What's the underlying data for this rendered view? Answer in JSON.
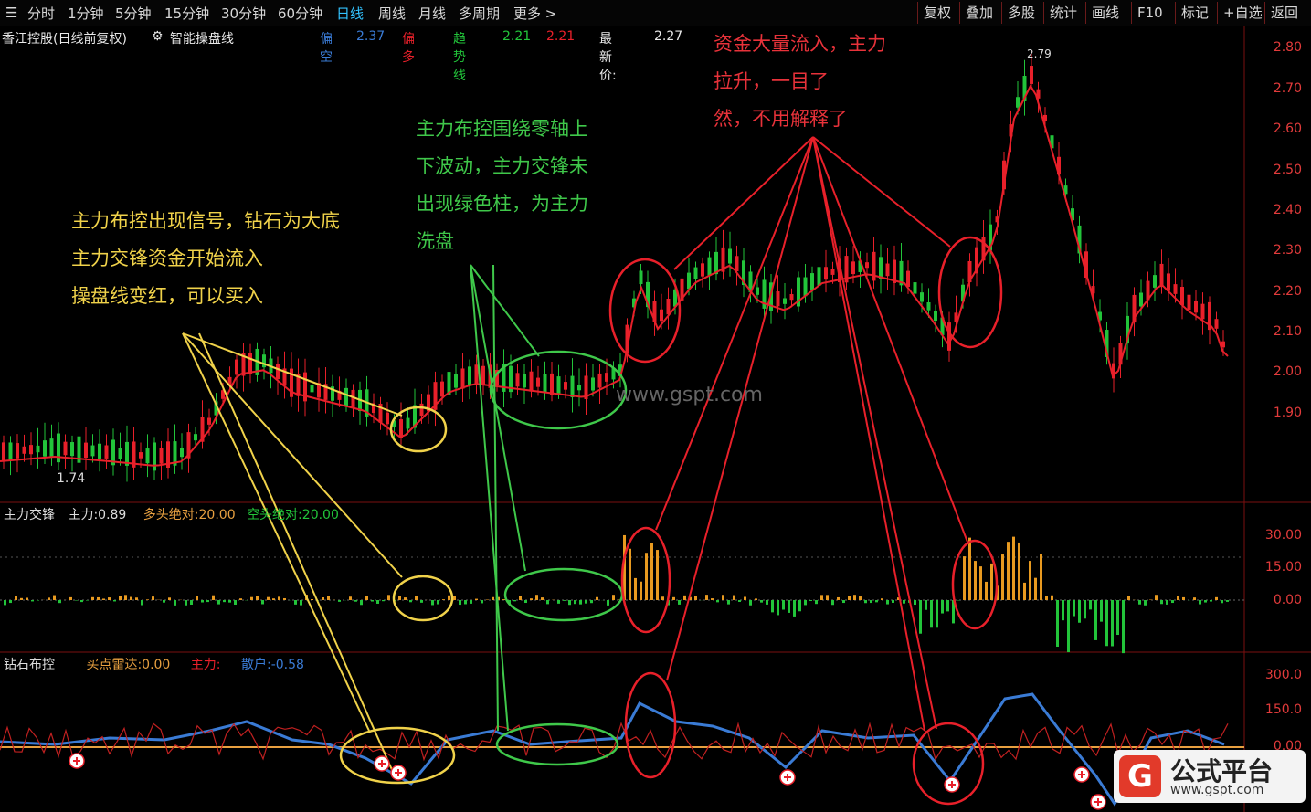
{
  "toolbar": {
    "periods": [
      "分时",
      "1分钟",
      "5分钟",
      "15分钟",
      "30分钟",
      "60分钟",
      "日线",
      "周线",
      "月线",
      "多周期",
      "更多 >"
    ],
    "active_period": "日线",
    "buttons": [
      "复权",
      "叠加",
      "多股",
      "统计",
      "画线",
      "F10",
      "标记",
      "+自选",
      "返回"
    ]
  },
  "info": {
    "stock": "香江控股(日线前复权)",
    "indicator": "智能操盘线",
    "empty_label": "偏空",
    "empty_value": "2.37",
    "multi_label": "偏多",
    "trend_label": "趋势线",
    "trend_value": "2.21",
    "trend_value2": "2.21",
    "latest_label": "最新价:",
    "latest_value": "2.27"
  },
  "price_axis": [
    "2.80",
    "2.70",
    "2.60",
    "2.50",
    "2.40",
    "2.30",
    "2.20",
    "2.10",
    "2.00",
    "1.90"
  ],
  "low_marker": "1.74",
  "high_marker": "2.79",
  "panel2": {
    "name": "主力交锋",
    "main_label": "主力:",
    "main_value": "0.89",
    "long_label": "多头绝对:",
    "long_value": "20.00",
    "short_label": "空头绝对:",
    "short_value": "20.00",
    "axis": [
      "30.00",
      "15.00",
      "0.00"
    ]
  },
  "panel3": {
    "name": "钻石布控",
    "buy_label": "买点雷达:",
    "buy_value": "0.00",
    "main_label": "主力:",
    "retail_label": "散户:",
    "retail_value": "-0.58",
    "axis": [
      "300.0",
      "150.0",
      "0.00"
    ]
  },
  "annotations": {
    "yellow": [
      "主力布控出现信号，钻石为大底",
      "主力交锋资金开始流入",
      "操盘线变红，可以买入"
    ],
    "green": [
      "主力布控围绕零轴上",
      "下波动，主力交锋未",
      "出现绿色柱，为主力",
      "洗盘"
    ],
    "red": [
      "资金大量流入，主力",
      "拉升，一目了",
      "然，不用解释了"
    ]
  },
  "watermark": "www.gspt.com",
  "logo": {
    "title": "公式平台",
    "url": "www.gspt.com",
    "mark": "G"
  },
  "colors": {
    "up": "#e8202a",
    "down": "#22c43a",
    "yellow": "#f0d24a",
    "green": "#3fc84a",
    "blue": "#3a7bd5",
    "axis": "#e23b3b"
  }
}
